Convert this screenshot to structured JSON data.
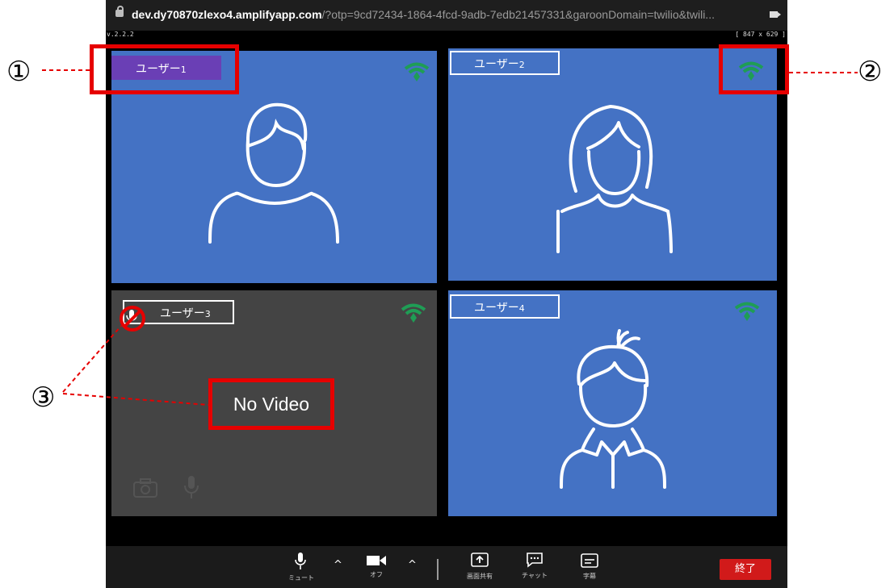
{
  "browser": {
    "url_host": "dev.dy70870zlexo4.amplifyapp.com",
    "url_rest": "/?otp=9cd72434-1864-4fcd-9adb-7edb21457331&garoonDomain=twilio&twili...",
    "version": "v.2.2.2",
    "dims": "[ 847 x 629 ]"
  },
  "tiles": [
    {
      "name": "ユーザー",
      "num": "1"
    },
    {
      "name": "ユーザー",
      "num": "2"
    },
    {
      "name": "ユーザー",
      "num": "3",
      "status": "No Video"
    },
    {
      "name": "ユーザー",
      "num": "4"
    }
  ],
  "toolbar": {
    "mute_label": "ミュート",
    "camera_label": "オフ",
    "share_label": "画面共有",
    "chat_label": "チャット",
    "caption_label": "字幕",
    "end_label": "終了"
  },
  "callouts": [
    "①",
    "②",
    "③"
  ],
  "colors": {
    "tile_blue": "#4472c4",
    "tile_gray": "#444444",
    "active_badge": "#6a3fb5",
    "signal_green": "#1f9d55",
    "end_button": "#d11a1a",
    "annotation_red": "#e60000"
  }
}
